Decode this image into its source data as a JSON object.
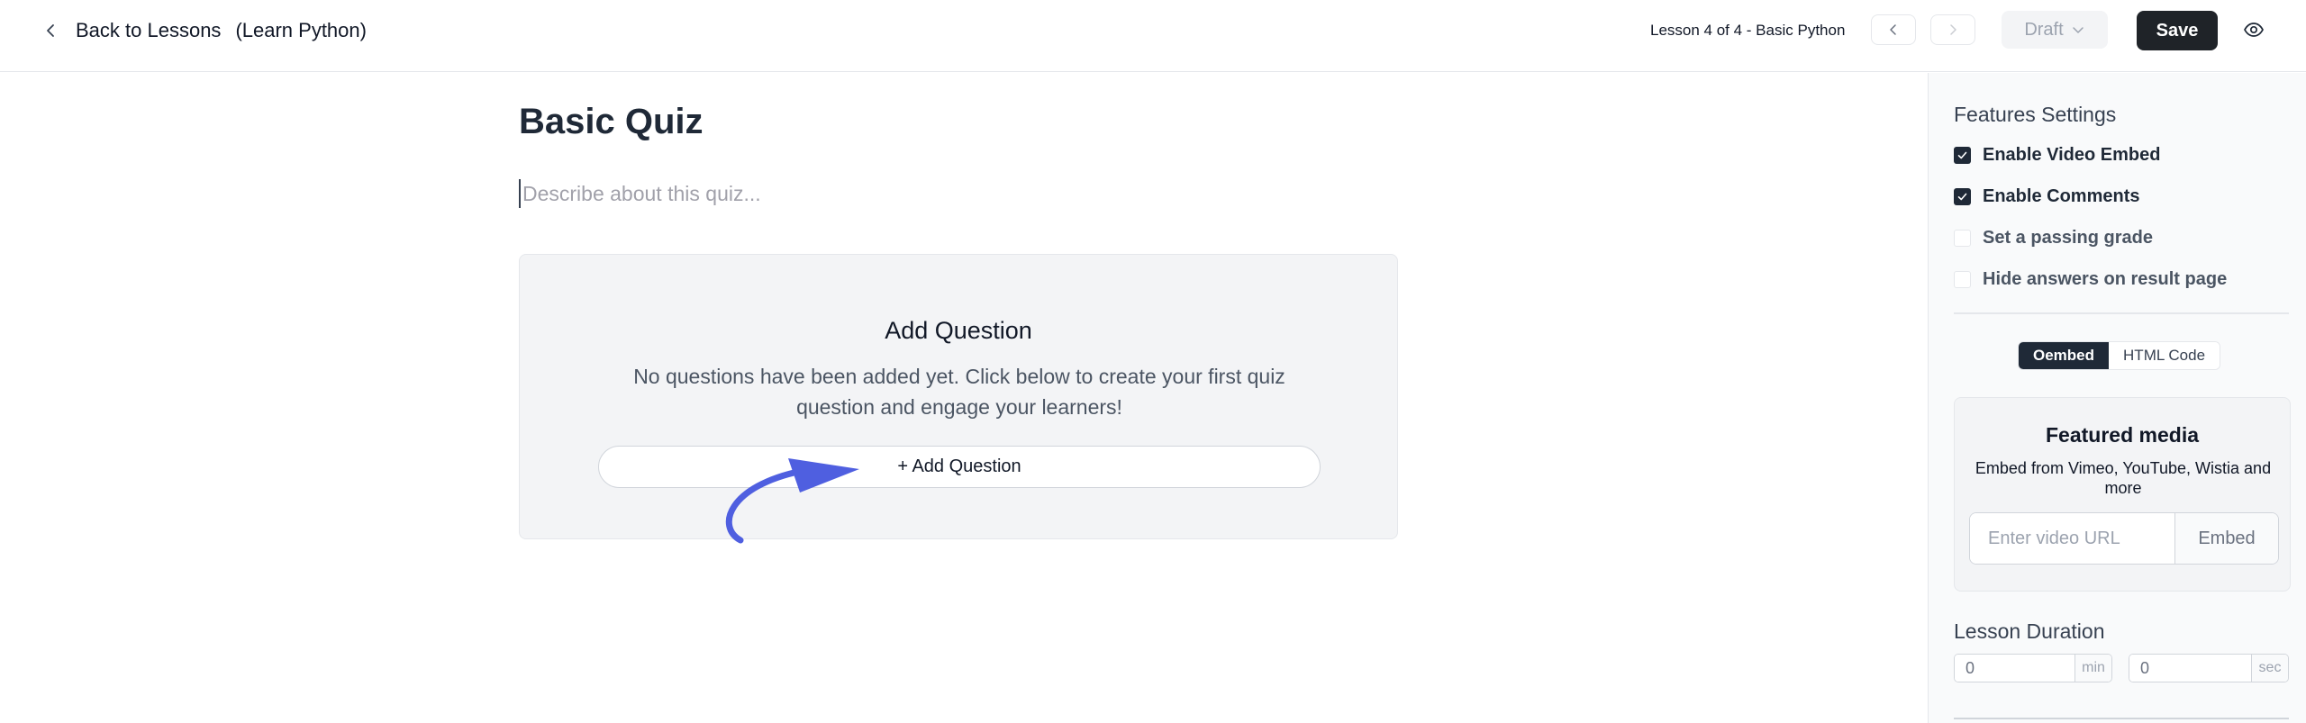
{
  "header": {
    "back_label": "Back to Lessons",
    "course_name": "(Learn Python)",
    "lesson_position": "Lesson 4 of 4 - Basic Python",
    "status": "Draft",
    "save_label": "Save"
  },
  "editor": {
    "title": "Basic Quiz",
    "description_placeholder": "Describe about this quiz..."
  },
  "questions": {
    "heading": "Add Question",
    "empty_message": "No questions have been added yet. Click below to create your first quiz question and engage your learners!",
    "add_button_label": "+ Add Question"
  },
  "sidebar": {
    "features_heading": "Features Settings",
    "features": [
      {
        "label": "Enable Video Embed",
        "checked": true
      },
      {
        "label": "Enable Comments",
        "checked": true
      },
      {
        "label": "Set a passing grade",
        "checked": false
      },
      {
        "label": "Hide answers on result page",
        "checked": false
      }
    ],
    "embed_tabs": [
      {
        "label": "Oembed",
        "active": true
      },
      {
        "label": "HTML Code",
        "active": false
      }
    ],
    "media": {
      "heading": "Featured media",
      "subtext": "Embed from Vimeo, YouTube, Wistia and more",
      "url_placeholder": "Enter video URL",
      "embed_label": "Embed"
    },
    "duration": {
      "heading": "Lesson Duration",
      "minutes": "0",
      "min_unit": "min",
      "seconds": "0",
      "sec_unit": "sec"
    }
  },
  "colors": {
    "primary_dark": "#1f2328",
    "annotation_arrow": "#4f5fe0",
    "sidebar_bg": "#f9fafb",
    "panel_bg": "#f3f4f6"
  }
}
